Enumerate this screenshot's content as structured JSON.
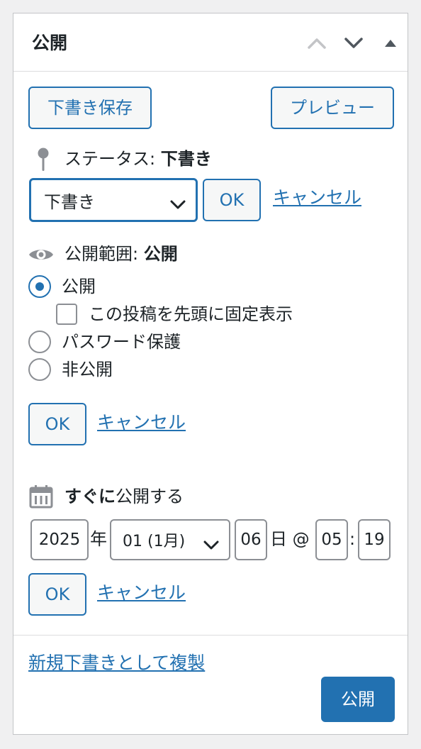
{
  "box": {
    "title": "公開",
    "controls": [
      "move-up-icon",
      "move-down-icon",
      "toggle-panel-icon"
    ]
  },
  "actions": {
    "save_draft": "下書き保存",
    "preview": "プレビュー"
  },
  "status": {
    "label": "ステータス:",
    "value": "下書き",
    "select_value": "下書き",
    "ok": "OK",
    "cancel": "キャンセル"
  },
  "visibility": {
    "label": "公開範囲:",
    "value": "公開",
    "options": [
      {
        "label": "公開",
        "selected": true
      },
      {
        "label": "パスワード保護",
        "selected": false
      },
      {
        "label": "非公開",
        "selected": false
      }
    ],
    "sticky_label": "この投稿を先頭に固定表示",
    "sticky_checked": false,
    "ok": "OK",
    "cancel": "キャンセル"
  },
  "schedule": {
    "label_bold": "すぐに",
    "label_rest": "公開する",
    "year": "2025",
    "year_suffix": "年",
    "month": "01 (1月)",
    "day": "06",
    "day_suffix": "日 @",
    "hour": "05",
    "colon": ":",
    "minute": "19",
    "ok": "OK",
    "cancel": "キャンセル"
  },
  "footer": {
    "duplicate_link": "新規下書きとして複製",
    "publish": "公開"
  },
  "colors": {
    "accent": "#2271b1",
    "border": "#c3c4c7",
    "background": "#f0f0f1"
  }
}
